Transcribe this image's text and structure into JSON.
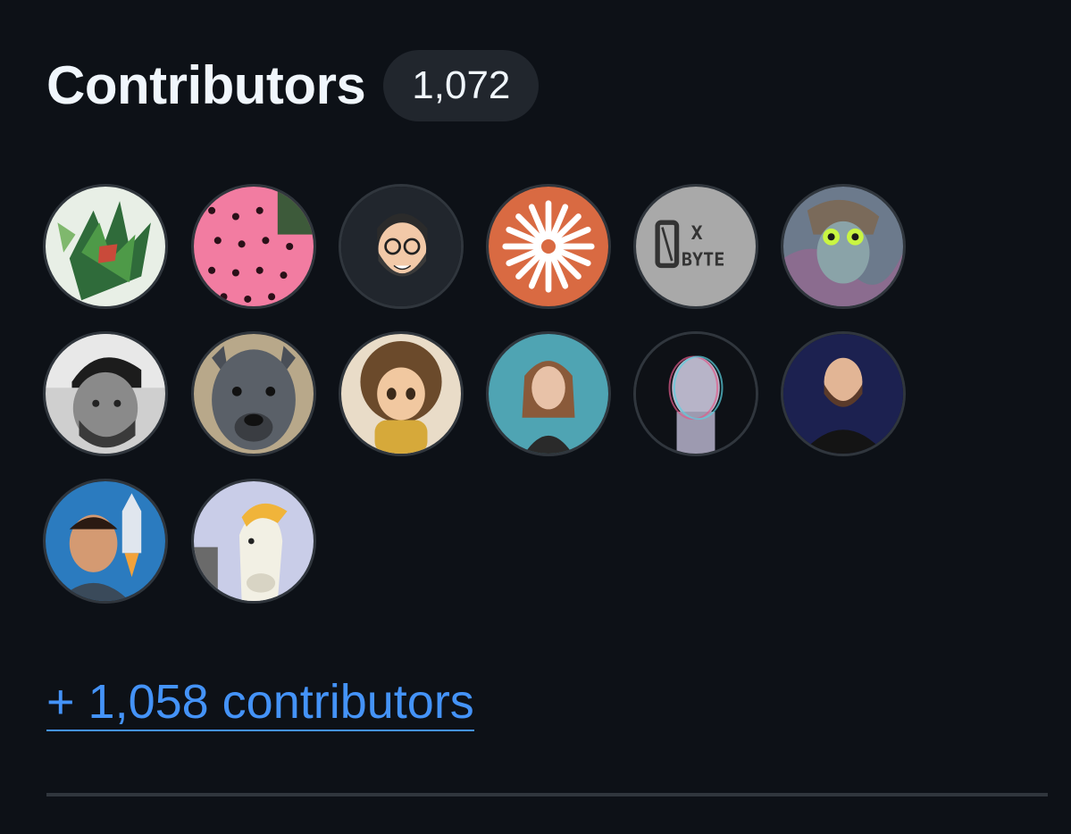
{
  "section": {
    "title": "Contributors",
    "count": "1,072"
  },
  "avatars": [
    {
      "name": "avatar-1",
      "icon": "leafy-character-avatar"
    },
    {
      "name": "avatar-2",
      "icon": "pink-heart-pattern-avatar"
    },
    {
      "name": "avatar-3",
      "icon": "bearded-glasses-emoji-avatar"
    },
    {
      "name": "avatar-4",
      "icon": "orange-starburst-avatar"
    },
    {
      "name": "avatar-5",
      "icon": "0xbyte-logo-avatar"
    },
    {
      "name": "avatar-6",
      "icon": "psychedelic-portrait-avatar"
    },
    {
      "name": "avatar-7",
      "icon": "beanie-selfie-avatar"
    },
    {
      "name": "avatar-8",
      "icon": "gray-dog-avatar"
    },
    {
      "name": "avatar-9",
      "icon": "curly-hair-cartoon-avatar"
    },
    {
      "name": "avatar-10",
      "icon": "woman-portrait-avatar"
    },
    {
      "name": "avatar-11",
      "icon": "glitch-face-avatar"
    },
    {
      "name": "avatar-12",
      "icon": "bearded-man-portrait-avatar"
    },
    {
      "name": "avatar-13",
      "icon": "rocket-man-avatar"
    },
    {
      "name": "avatar-14",
      "icon": "unicorn-avatar"
    }
  ],
  "logo_text": {
    "top": "0",
    "x": "X",
    "bottom": "BYTE"
  },
  "more_link": {
    "label": "+ 1,058 contributors"
  },
  "colors": {
    "background": "#0d1117",
    "link": "#4493f8",
    "badge_bg": "#21262d",
    "avatar_border": "#30363d"
  }
}
